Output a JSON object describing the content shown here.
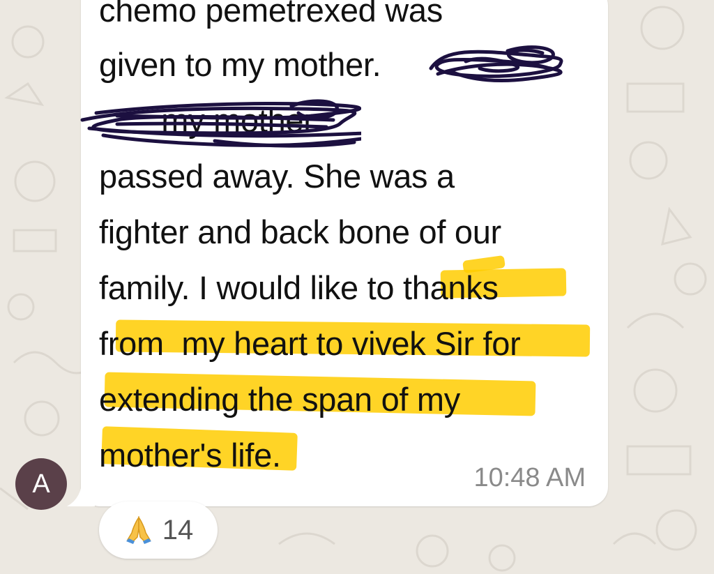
{
  "message": {
    "lines": [
      "chemo pemetrexed was",
      "given to my mother. ",
      "       my mother",
      "passed away. She was a",
      "fighter and back bone of our",
      "family. I would like to thanks",
      "from  my heart to vivek Sir for",
      "extending the span of my",
      "mother's life."
    ],
    "timestamp": "10:48 AM"
  },
  "sender": {
    "avatar_letter": "A"
  },
  "reaction": {
    "icon": "folded-hands-icon",
    "count": "14"
  },
  "colors": {
    "background": "#ece8e1",
    "bubble": "#ffffff",
    "highlight": "#ffcc00",
    "scribble": "#1c1040",
    "avatar": "#5a4049"
  }
}
